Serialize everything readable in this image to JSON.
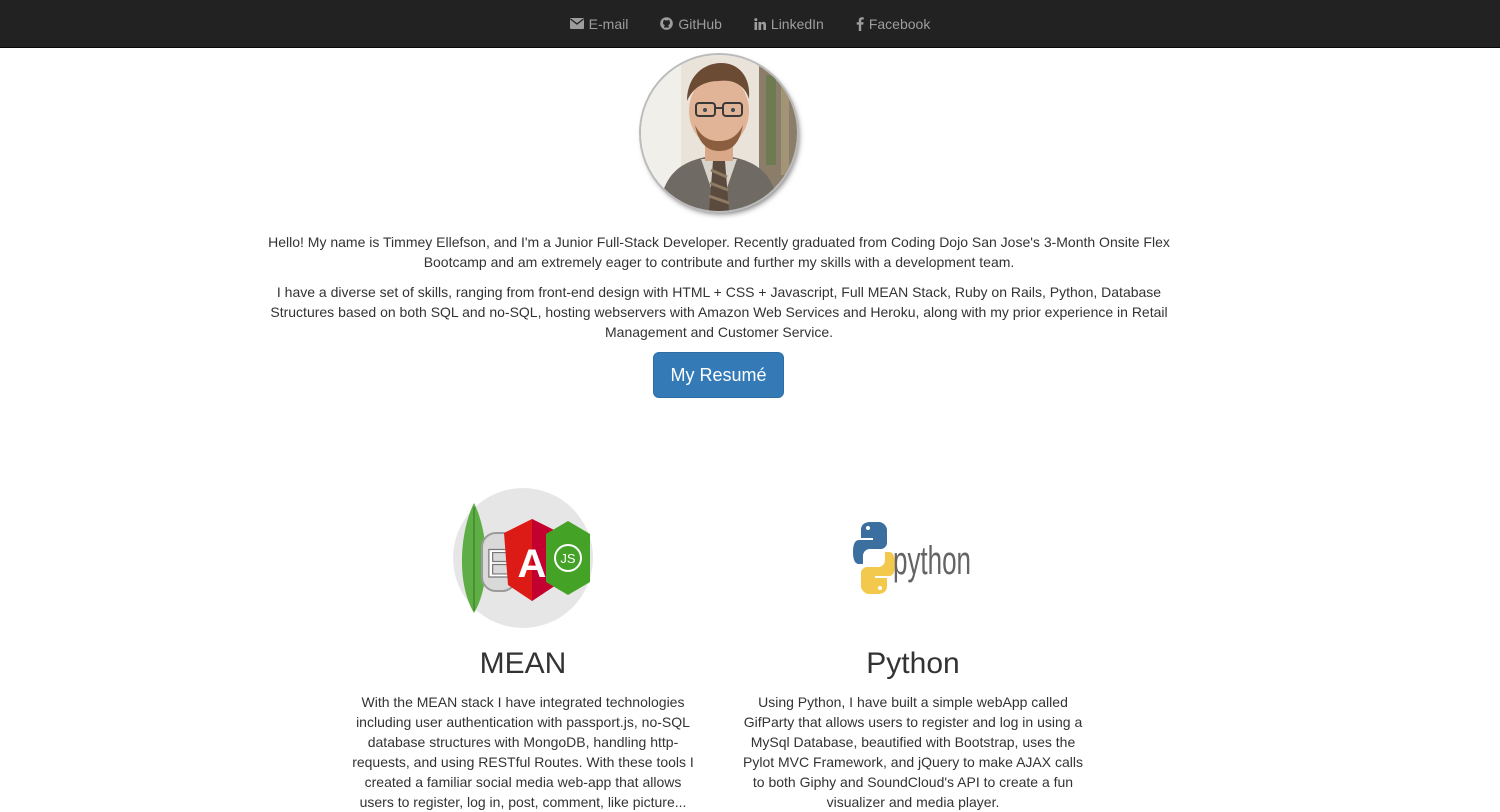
{
  "nav": {
    "items": [
      {
        "label": "E-mail",
        "icon": "envelope-icon"
      },
      {
        "label": "GitHub",
        "icon": "github-icon"
      },
      {
        "label": "LinkedIn",
        "icon": "linkedin-icon"
      },
      {
        "label": "Facebook",
        "icon": "facebook-icon"
      }
    ]
  },
  "profile": {
    "bio_intro": "Hello! My name is Timmey Ellefson, and I'm a Junior Full-Stack Developer. Recently graduated from Coding Dojo San Jose's 3-Month Onsite Flex Bootcamp and am extremely eager to contribute and further my skills with a development team.",
    "bio_skills": "I have a diverse set of skills, ranging from front-end design with HTML + CSS + Javascript, Full MEAN Stack, Ruby on Rails, Python, Database Structures based on both SQL and no-SQL, hosting webservers with Amazon Web Services and Heroku, along with my prior experience in Retail Management and Customer Service.",
    "resume_button": "My Resumé"
  },
  "skills": [
    {
      "title": "MEAN",
      "logo_text": "E",
      "logo_text_2": "A",
      "logo_text_3": "JS",
      "description": "With the MEAN stack I have integrated technologies including user authentication with passport.js, no-SQL database structures with MongoDB, handling http-requests, and using RESTful Routes. With these tools I created a familiar social media web-app that allows users to register, log in, post, comment, like picture..."
    },
    {
      "title": "Python",
      "logo_text": "python",
      "description": "Using Python, I have built a simple webApp called GifParty that allows users to register and log in using a MySql Database, beautified with Bootstrap, uses the Pylot MVC Framework, and jQuery to make AJAX calls to both Giphy and SoundCloud's API to create a fun visualizer and media player."
    }
  ],
  "colors": {
    "navbar_bg": "#222222",
    "nav_text": "#9d9d9d",
    "button_primary": "#337ab7",
    "text": "#333333"
  }
}
